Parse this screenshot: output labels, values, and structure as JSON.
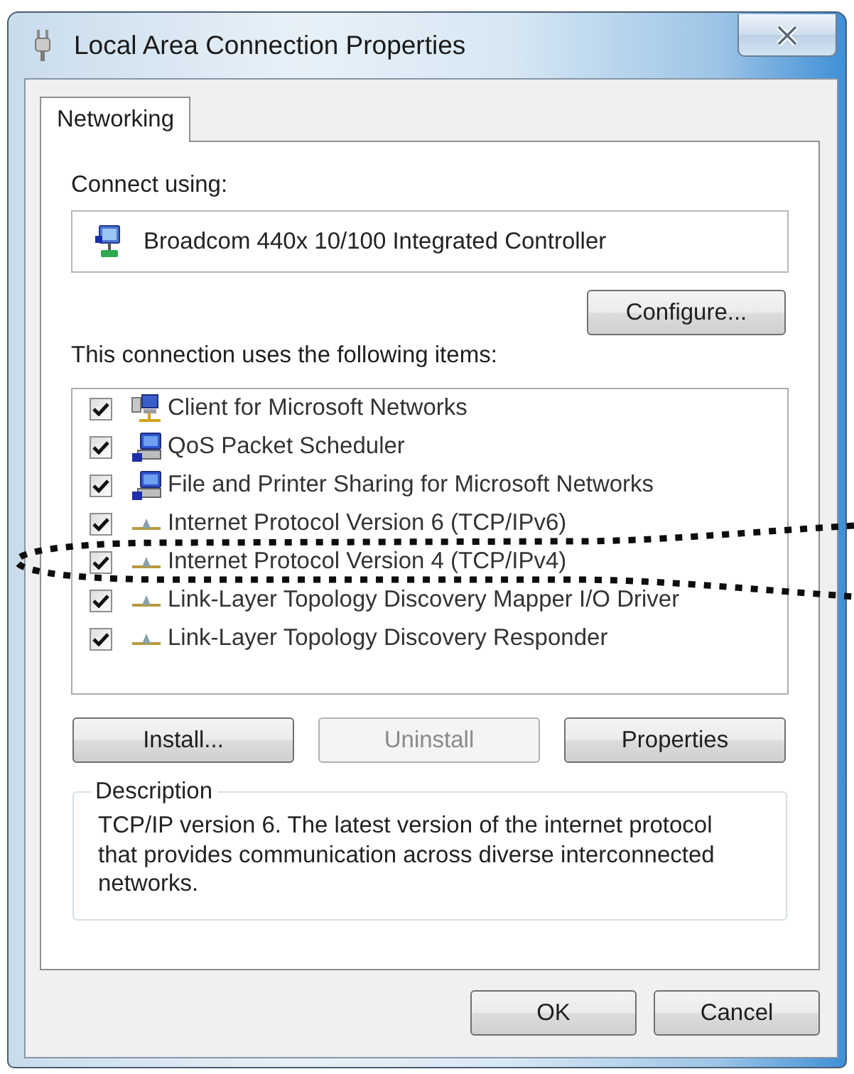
{
  "window": {
    "title": "Local Area Connection Properties"
  },
  "tabs": [
    {
      "label": "Networking",
      "selected": true
    }
  ],
  "connect_using": {
    "label": "Connect using:",
    "adapter": "Broadcom 440x 10/100 Integrated Controller",
    "button": "Configure..."
  },
  "items_list": {
    "label": "This connection uses the following items:",
    "items": [
      {
        "label": "Client for Microsoft Networks",
        "checked": true,
        "kind": "client"
      },
      {
        "label": "QoS Packet Scheduler",
        "checked": true,
        "kind": "service"
      },
      {
        "label": "File and Printer Sharing for Microsoft Networks",
        "checked": true,
        "kind": "service"
      },
      {
        "label": "Internet Protocol Version 6 (TCP/IPv6)",
        "checked": true,
        "kind": "protocol"
      },
      {
        "label": "Internet Protocol Version 4 (TCP/IPv4)",
        "checked": true,
        "kind": "protocol"
      },
      {
        "label": "Link-Layer Topology Discovery Mapper I/O Driver",
        "checked": true,
        "kind": "protocol"
      },
      {
        "label": "Link-Layer Topology Discovery Responder",
        "checked": true,
        "kind": "protocol"
      }
    ]
  },
  "item_buttons": [
    {
      "label": "Install...",
      "disabled": false
    },
    {
      "label": "Uninstall",
      "disabled": true
    },
    {
      "label": "Properties",
      "disabled": false
    }
  ],
  "description": {
    "title": "Description",
    "text": "TCP/IP version 6. The latest version of the internet protocol that provides communication across diverse interconnected networks."
  },
  "dialog_buttons": [
    {
      "label": "OK"
    },
    {
      "label": "Cancel"
    }
  ],
  "annotation": {
    "kind": "ellipse"
  }
}
